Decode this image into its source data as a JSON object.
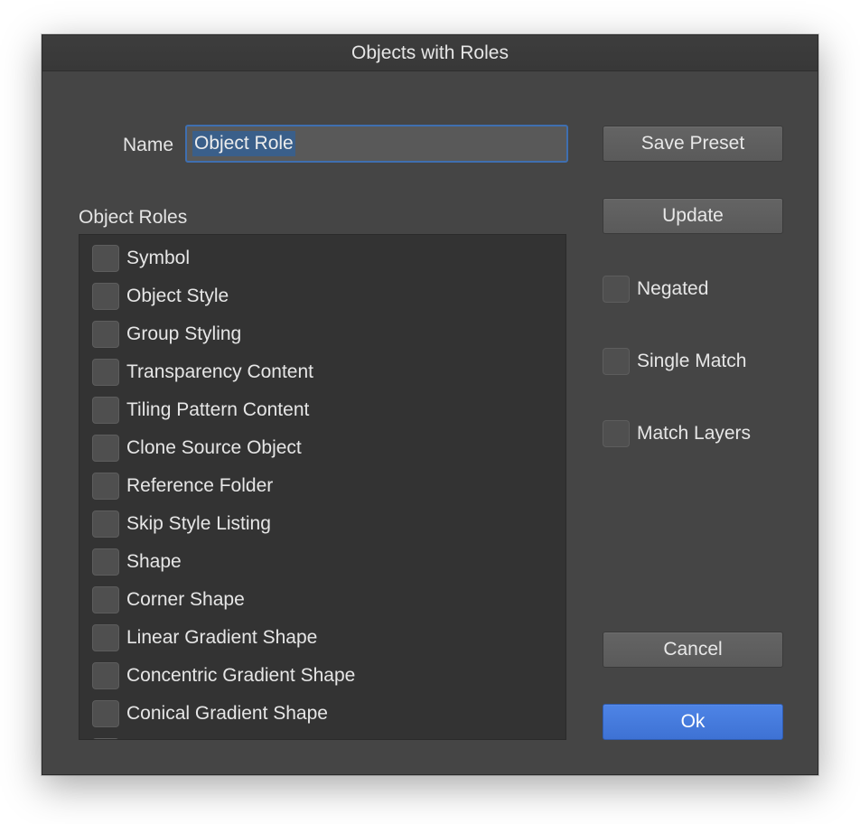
{
  "window": {
    "title": "Objects with Roles"
  },
  "name_field": {
    "label": "Name",
    "value": "Object Role"
  },
  "roles": {
    "label": "Object Roles",
    "items": [
      "Symbol",
      "Object Style",
      "Group Styling",
      "Transparency Content",
      "Tiling Pattern Content",
      "Clone Source Object",
      "Reference Folder",
      "Skip Style Listing",
      "Shape",
      "Corner Shape",
      "Linear Gradient Shape",
      "Concentric Gradient Shape",
      "Conical Gradient Shape"
    ]
  },
  "buttons": {
    "save_preset": "Save Preset",
    "update": "Update",
    "cancel": "Cancel",
    "ok": "Ok"
  },
  "options": {
    "negated": "Negated",
    "single_match": "Single Match",
    "match_layers": "Match Layers"
  },
  "colors": {
    "dialog_bg": "#454545",
    "accent": "#4a7fe0"
  }
}
